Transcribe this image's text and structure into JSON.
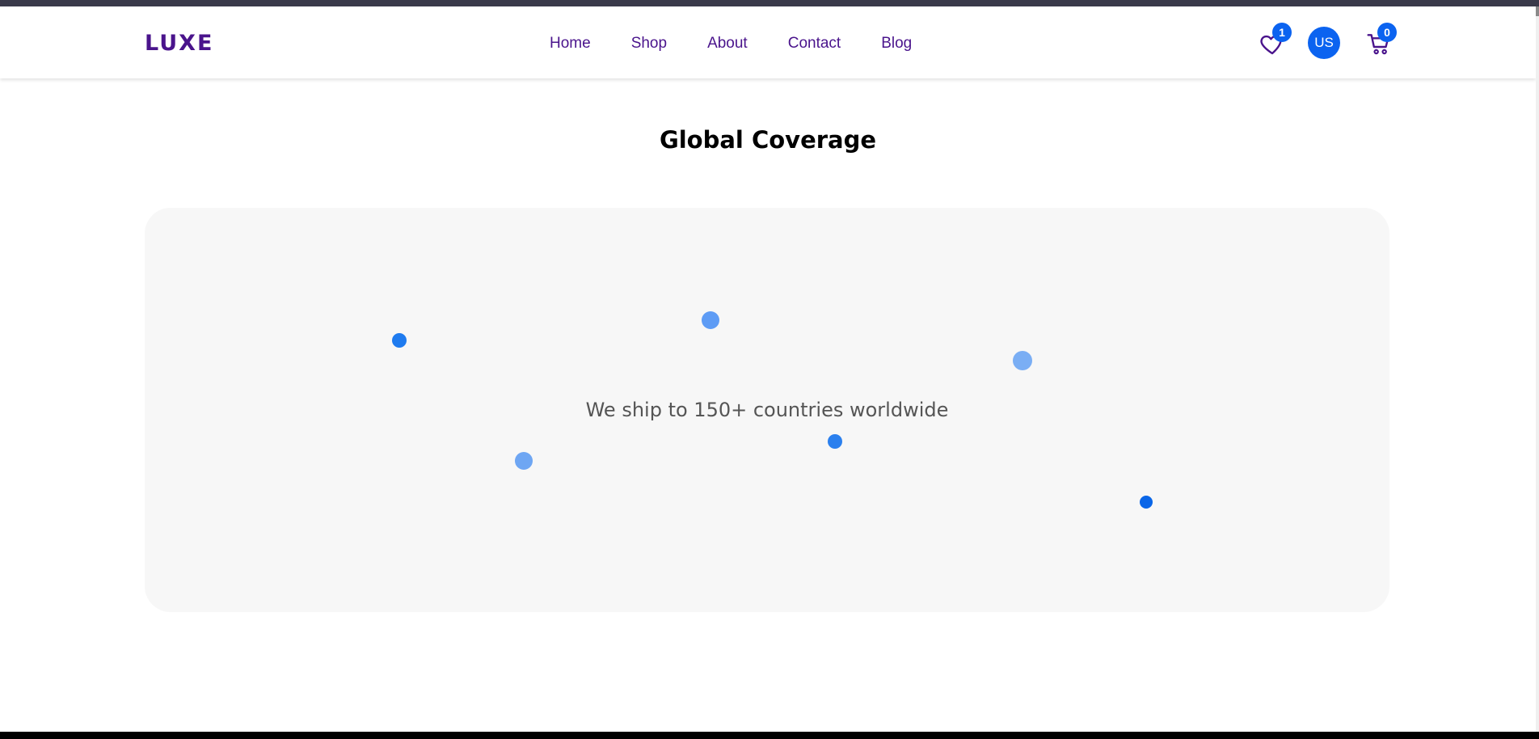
{
  "header": {
    "logo": "LUXE",
    "nav": [
      "Home",
      "Shop",
      "About",
      "Contact",
      "Blog"
    ],
    "wishlist_count": "1",
    "avatar_initials": "US",
    "cart_count": "0"
  },
  "main": {
    "title": "Global Coverage",
    "map_text": "We ship to 150+ countries worldwide"
  },
  "colors": {
    "brand": "#4a148c",
    "accent": "#0b63f0",
    "card_bg": "#f7f7f7"
  },
  "icons": [
    "heart-icon",
    "cart-icon"
  ]
}
